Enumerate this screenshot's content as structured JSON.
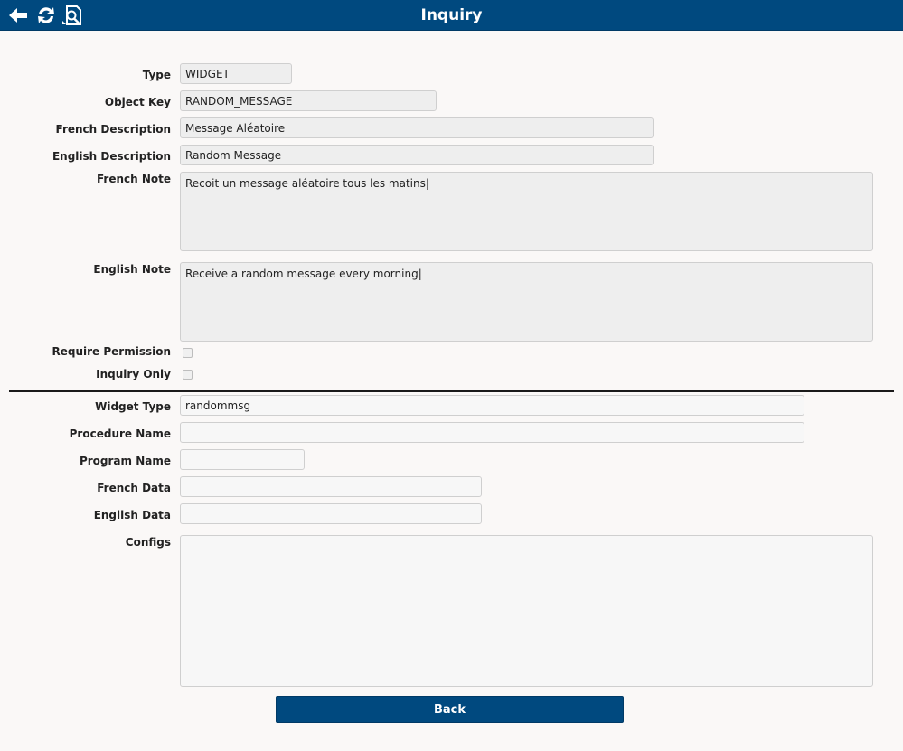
{
  "header": {
    "title": "Inquiry",
    "icons": [
      "back-arrow-icon",
      "refresh-icon",
      "search-document-icon"
    ],
    "background": "#00497f"
  },
  "form": {
    "type": {
      "label": "Type",
      "value": "WIDGET"
    },
    "object_key": {
      "label": "Object Key",
      "value": "RANDOM_MESSAGE"
    },
    "french_description": {
      "label": "French Description",
      "value": "Message Aléatoire"
    },
    "english_description": {
      "label": "English Description",
      "value": "Random Message"
    },
    "french_note": {
      "label": "French Note",
      "value": "Recoit un message aléatoire tous les matins|"
    },
    "english_note": {
      "label": "English Note",
      "value": "Receive a random message every morning|"
    },
    "require_permission": {
      "label": "Require Permission",
      "checked": false
    },
    "inquiry_only": {
      "label": "Inquiry Only",
      "checked": false
    },
    "widget_type": {
      "label": "Widget Type",
      "value": "randommsg"
    },
    "procedure_name": {
      "label": "Procedure Name",
      "value": ""
    },
    "program_name": {
      "label": "Program Name",
      "value": ""
    },
    "french_data": {
      "label": "French Data",
      "value": ""
    },
    "english_data": {
      "label": "English Data",
      "value": ""
    },
    "configs": {
      "label": "Configs",
      "value": ""
    }
  },
  "actions": {
    "back_label": "Back"
  }
}
